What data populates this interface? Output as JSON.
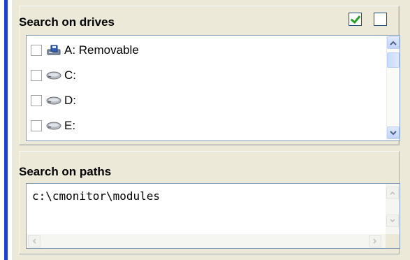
{
  "drives_panel": {
    "title": "Search on drives",
    "select_all_checked": true,
    "select_none_checked": false,
    "drives": [
      {
        "label": "A: Removable",
        "icon": "floppy-drive-icon",
        "checked": false
      },
      {
        "label": "C:",
        "icon": "hard-drive-icon",
        "checked": false
      },
      {
        "label": "D:",
        "icon": "hard-drive-icon",
        "checked": false
      },
      {
        "label": "E:",
        "icon": "hard-drive-icon",
        "checked": false
      }
    ]
  },
  "paths_panel": {
    "title": "Search on paths",
    "value": "c:\\cmonitor\\modules"
  },
  "colors": {
    "accent_bar": "#1f3fd0",
    "panel_bg": "#ece9d8",
    "check_green": "#21a121"
  }
}
